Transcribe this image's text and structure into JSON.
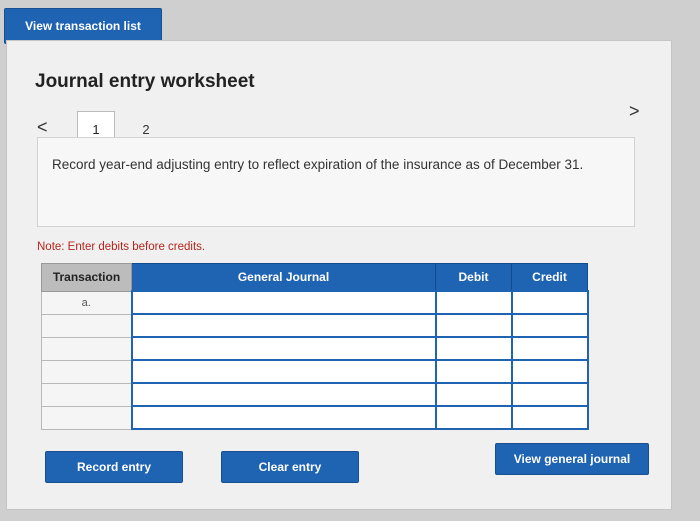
{
  "top_button": {
    "label": "View transaction list"
  },
  "worksheet": {
    "title": "Journal entry worksheet",
    "tabs": [
      {
        "label": "1"
      },
      {
        "label": "2"
      }
    ],
    "prev_icon": "<",
    "next_icon": ">",
    "instruction": "Record year-end adjusting entry to reflect expiration of the insurance as of December 31.",
    "note": "Note: Enter debits before credits."
  },
  "table": {
    "headers": {
      "transaction": "Transaction",
      "general_journal": "General Journal",
      "debit": "Debit",
      "credit": "Credit"
    },
    "rows": [
      {
        "transaction": "a.",
        "account": "",
        "debit": "",
        "credit": ""
      },
      {
        "transaction": "",
        "account": "",
        "debit": "",
        "credit": ""
      },
      {
        "transaction": "",
        "account": "",
        "debit": "",
        "credit": ""
      },
      {
        "transaction": "",
        "account": "",
        "debit": "",
        "credit": ""
      },
      {
        "transaction": "",
        "account": "",
        "debit": "",
        "credit": ""
      },
      {
        "transaction": "",
        "account": "",
        "debit": "",
        "credit": ""
      }
    ]
  },
  "buttons": {
    "record": "Record entry",
    "clear": "Clear entry",
    "view_journal": "View general journal"
  }
}
